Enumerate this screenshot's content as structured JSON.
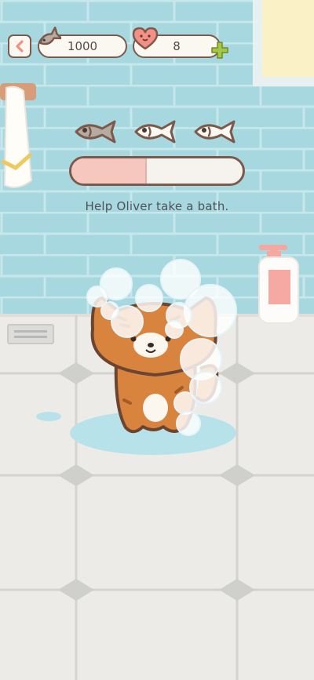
{
  "hud": {
    "coins": "1000",
    "hearts": "8"
  },
  "task": {
    "fish_total": 3,
    "fish_earned": 1,
    "progress": 0.43,
    "hint": "Help Oliver take a bath."
  },
  "colors": {
    "wall": "#a8d8df",
    "wall_mortar": "#c9e9ee",
    "floor": "#ecebe7",
    "tile_grout": "#cfcfcd",
    "outline": "#7b5a4c",
    "accent_pink": "#f48f86",
    "accent_green": "#a4c844",
    "progress_fill": "#f6c7bf",
    "cat_fur": "#d9843e",
    "water": "#b8e2e9"
  }
}
